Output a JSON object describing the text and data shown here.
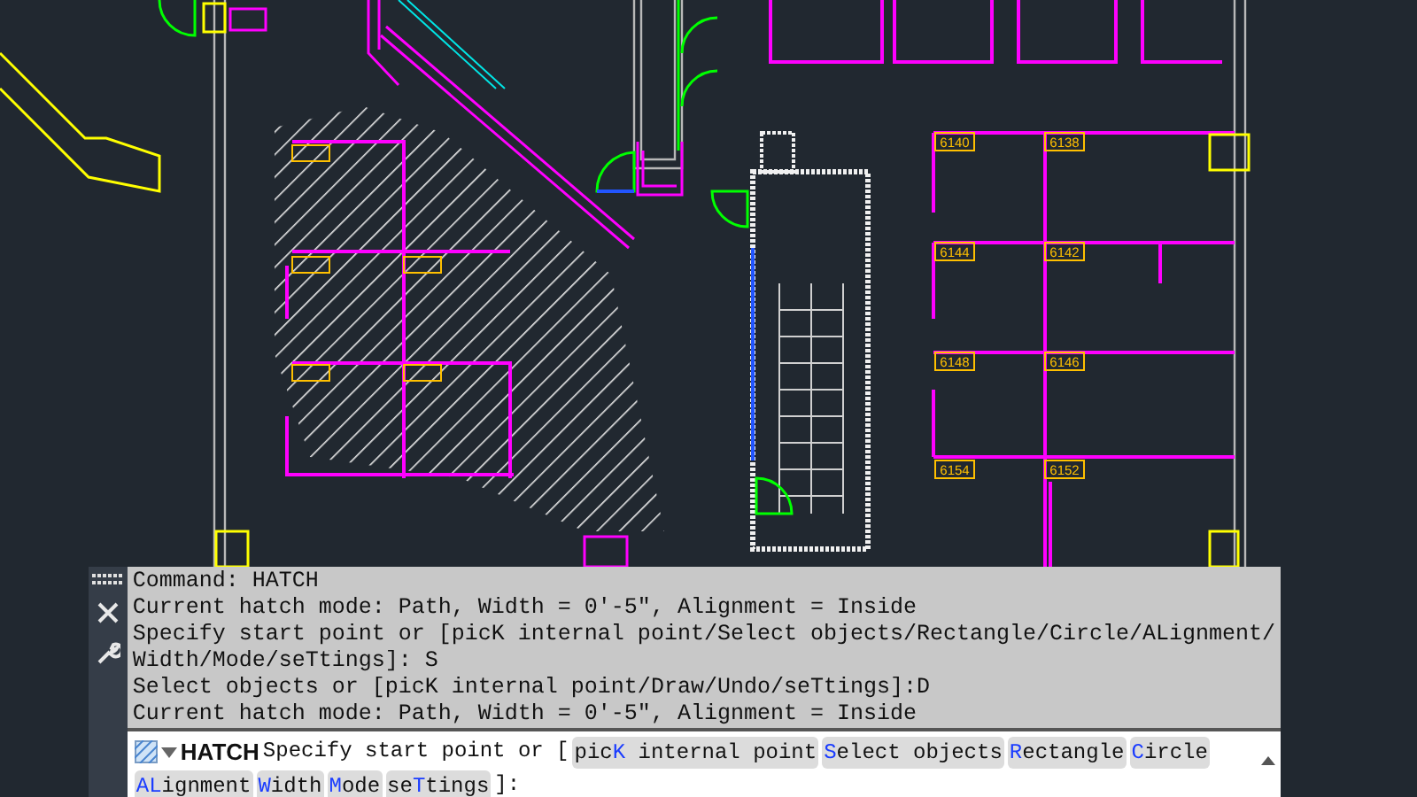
{
  "drawing": {
    "room_labels": [
      "6140",
      "6138",
      "6144",
      "6142",
      "6148",
      "6146",
      "6154",
      "6152"
    ]
  },
  "command_history": [
    "Command: HATCH",
    "Current hatch mode: Path, Width = 0'-5\", Alignment = Inside",
    "Specify start point or [picK internal point/Select objects/Rectangle/Circle/ALignment/",
    "Width/Mode/seTtings]: S",
    "Select objects or [picK internal point/Draw/Undo/seTtings]:D",
    "Current hatch mode: Path, Width = 0'-5\", Alignment = Inside"
  ],
  "command_line": {
    "command": "HATCH",
    "prompt": "Specify start point or [",
    "options": [
      {
        "pre": "pic",
        "key": "K",
        "post": " internal point"
      },
      {
        "key": "S",
        "post": "elect objects"
      },
      {
        "key": "R",
        "post": "ectangle"
      },
      {
        "key": "C",
        "post": "ircle"
      },
      {
        "key": "AL",
        "post": "ignment"
      },
      {
        "key": "W",
        "post": "idth"
      },
      {
        "key": "M",
        "post": "ode"
      },
      {
        "pre": "se",
        "key": "T",
        "post": "tings"
      }
    ],
    "suffix": "]:"
  }
}
